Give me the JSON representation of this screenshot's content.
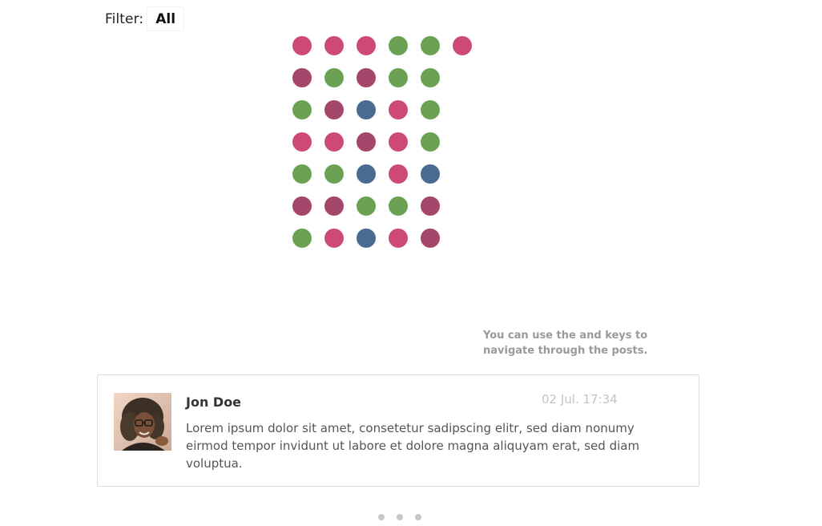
{
  "filter": {
    "label": "Filter:",
    "value": "All"
  },
  "dot_grid": {
    "colors": {
      "pink": "#cc4a75",
      "plum": "#a4456a",
      "green": "#6aa154",
      "blue": "#4a6b8f"
    },
    "rows": [
      [
        "pink",
        "pink",
        "pink",
        "green",
        "green",
        "pink"
      ],
      [
        "plum",
        "green",
        "plum",
        "green",
        "green"
      ],
      [
        "green",
        "plum",
        "blue",
        "pink",
        "green"
      ],
      [
        "pink",
        "pink",
        "plum",
        "pink",
        "green"
      ],
      [
        "green",
        "green",
        "blue",
        "pink",
        "blue"
      ],
      [
        "plum",
        "plum",
        "green",
        "green",
        "plum"
      ],
      [
        "green",
        "pink",
        "blue",
        "pink",
        "plum"
      ]
    ]
  },
  "hint": {
    "line1": "You can use the and keys to",
    "line2": "navigate through the posts."
  },
  "post": {
    "author": "Jon Doe",
    "timestamp": "02 Jul. 17:34",
    "text": "Lorem ipsum dolor sit amet, consetetur sadipscing elitr, sed diam nonumy eirmod tempor invidunt ut labore et dolore magna aliquyam erat, sed diam voluptua."
  },
  "pagination": {
    "count": 3
  }
}
